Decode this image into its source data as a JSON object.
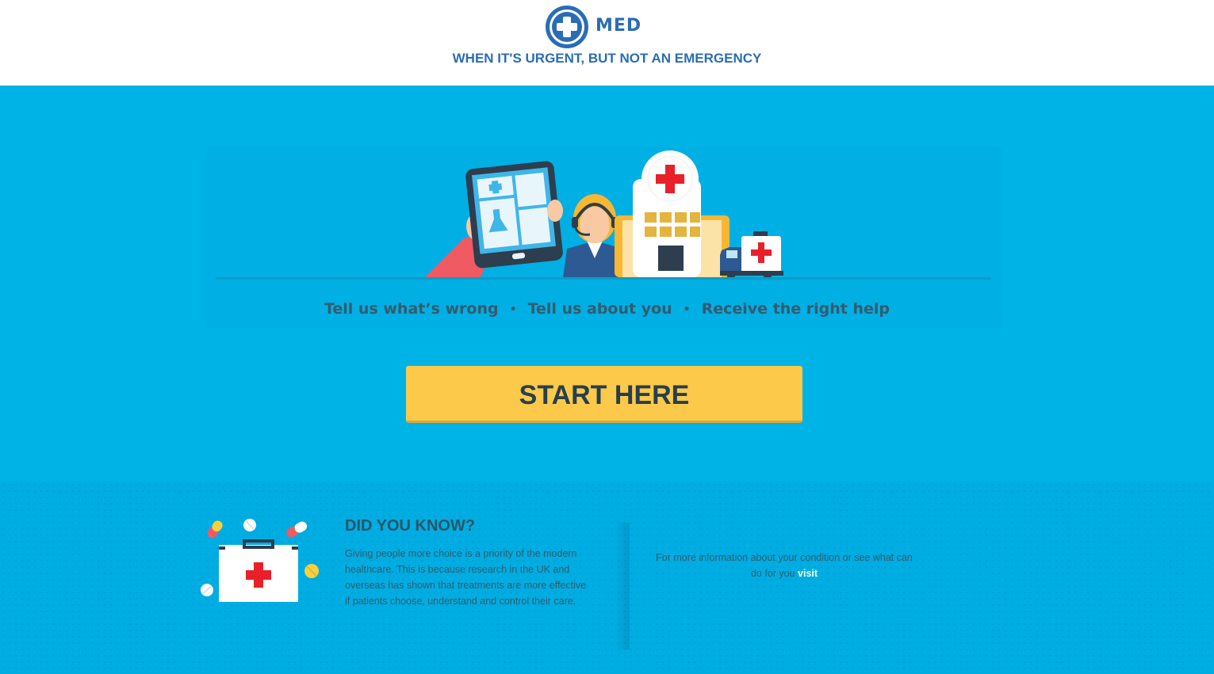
{
  "header": {
    "brand": "MED",
    "tagline": "WHEN IT'S URGENT, BUT NOT AN EMERGENCY"
  },
  "hero": {
    "steps": [
      "Tell us what’s wrong",
      "Tell us about you",
      "Receive the right help"
    ],
    "separator": "•"
  },
  "cta": {
    "label": "START HERE"
  },
  "did_you_know": {
    "title": "DID YOU KNOW?",
    "text": "Giving people more choice is a priority of the modern healthcare. This is because research in the UK and overseas has shown that treatments are more effective if patients choose, understand and control their care."
  },
  "info": {
    "text": "For more information about your condition or see what can do for you",
    "link_label": "visit"
  },
  "colors": {
    "brand_blue": "#2a6db5",
    "background": "#00b3e6",
    "cta_yellow": "#fdc94a",
    "cross_red": "#e8202a"
  }
}
